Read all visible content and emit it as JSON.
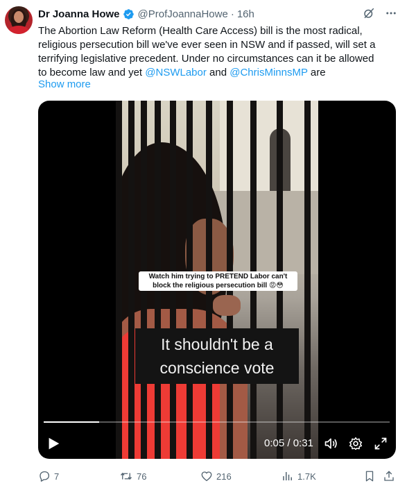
{
  "tweet": {
    "author_name": "Dr Joanna Howe",
    "handle": "@ProfJoannaHowe",
    "separator": "·",
    "time": "16h",
    "text_lines": [
      "The Abortion Law Reform (Health Care Access) bill is the most radical,",
      "religious persecution bill we've ever seen in NSW and if passed, will set a",
      "terrifying legislative precedent. Under no circumstances can it be allowed",
      "to become law and yet "
    ],
    "mention_1": "@NSWLabor",
    "connector": " and ",
    "mention_2": "@ChrisMinnsMP",
    "trailing": " are",
    "show_more": "Show more"
  },
  "video": {
    "overlay_line_1": "Watch him trying to PRETEND Labor can't",
    "overlay_line_2": "block the religious persecution bill 😡😳",
    "subtitle_line_1": "It shouldn't be a",
    "subtitle_line_2": "conscience vote",
    "time_display": "0:05 / 0:31",
    "progress_fraction": 0.16
  },
  "actions": {
    "replies": "7",
    "reposts": "76",
    "likes": "216",
    "views": "1.7K"
  },
  "colors": {
    "accent": "#1d9bf0",
    "muted": "#536471",
    "text": "#0f1419"
  },
  "icons": {
    "verified": "verified-badge-icon",
    "grok": "grok-icon",
    "more": "more-icon",
    "reply": "reply-icon",
    "repost": "repost-icon",
    "like": "like-icon",
    "views": "views-icon",
    "bookmark": "bookmark-icon",
    "share": "share-icon",
    "play": "play-icon",
    "volume": "volume-icon",
    "settings": "settings-icon",
    "fullscreen": "fullscreen-icon"
  }
}
